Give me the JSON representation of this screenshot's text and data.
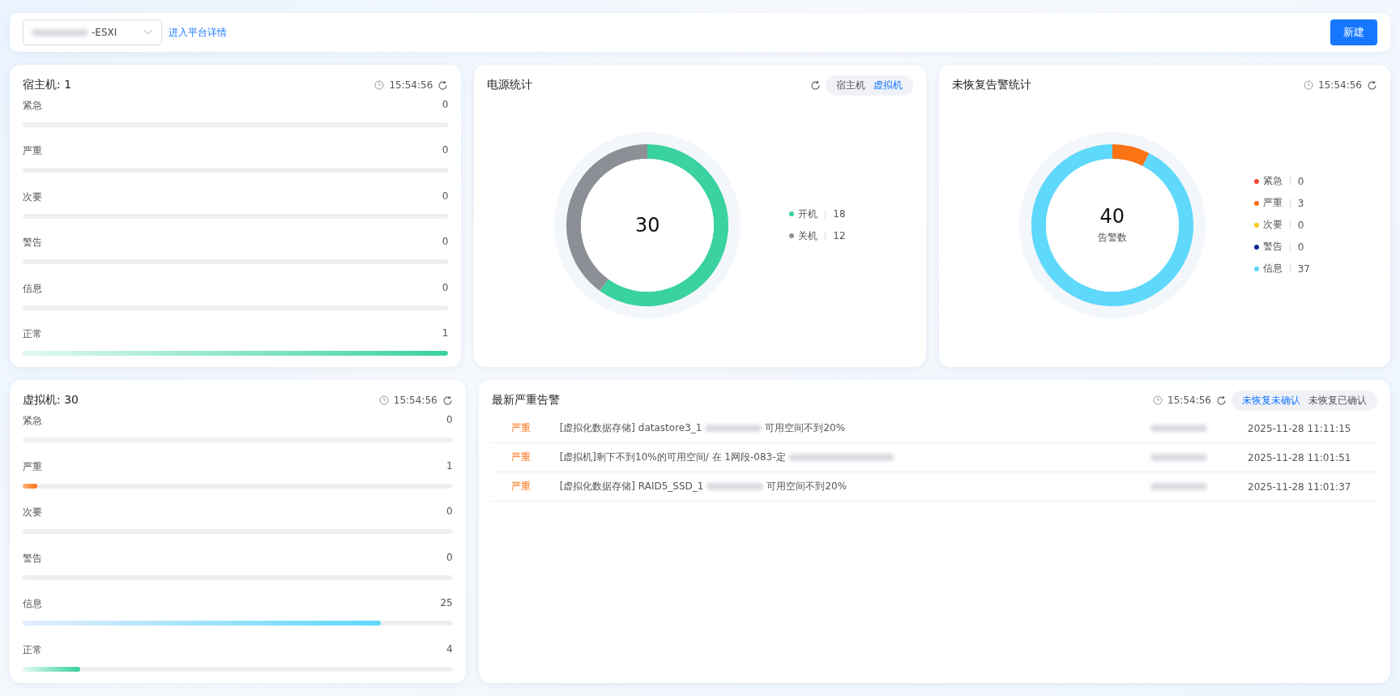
{
  "toolbar": {
    "platform_select": {
      "value": "-ESXI"
    },
    "detail_link": "进入平台详情",
    "new_button": "新建"
  },
  "host_card": {
    "title": "宿主机: 1",
    "time": "15:54:56",
    "rows": [
      {
        "label": "紧急",
        "count": "0",
        "kind": "urgent"
      },
      {
        "label": "严重",
        "count": "0",
        "kind": "critical"
      },
      {
        "label": "次要",
        "count": "0",
        "kind": "minor"
      },
      {
        "label": "警告",
        "count": "0",
        "kind": "warning"
      },
      {
        "label": "信息",
        "count": "0",
        "kind": "info"
      },
      {
        "label": "正常",
        "count": "1",
        "level": 1,
        "kind": "normal"
      }
    ]
  },
  "power_card": {
    "title": "电源统计",
    "tabs": [
      {
        "label": "宿主机",
        "selected": false
      },
      {
        "label": "虚拟机",
        "selected": true
      }
    ],
    "total": "30",
    "legend": [
      {
        "count": "18",
        "color": "#3ad29f"
      },
      {
        "count": "12",
        "color": "#8c8f96"
      }
    ],
    "chart_data": {
      "type": "donut",
      "categories": [
        "开机",
        "关机"
      ],
      "values": [
        60,
        40
      ]
    }
  },
  "alarm_card": {
    "title": "未恢复告警统计",
    "time": "15:54:56",
    "total": "40",
    "total_label": "告警数",
    "legend": [
      {
        "count": "0",
        "color": "#f5483b"
      },
      {
        "count": "3",
        "color": "#fa7315"
      },
      {
        "count": "0",
        "color": "#fac715"
      },
      {
        "count": "0",
        "color": "#0a2a9a"
      },
      {
        "count": "37",
        "color": "#5ed8fb"
      }
    ],
    "chart_data": {
      "type": "donut",
      "categories": [
        "紧急",
        "严重",
        "次要",
        "警告",
        "信息"
      ],
      "values": [
        0,
        7.5,
        0,
        0,
        92.5
      ]
    }
  },
  "vm_card": {
    "title": "虚拟机: 30",
    "time": "15:54:56",
    "rows": [
      {
        "label": "紧急",
        "count": "0",
        "kind": "urgent"
      },
      {
        "label": "严重",
        "count": "1",
        "level": 0.033,
        "kind": "critical"
      },
      {
        "label": "次要",
        "count": "0",
        "kind": "minor"
      },
      {
        "label": "警告",
        "count": "0",
        "kind": "warning"
      },
      {
        "label": "信息",
        "count": "25",
        "level": 0.833,
        "kind": "info"
      },
      {
        "label": "正常",
        "count": "4",
        "level": 0.133,
        "kind": "normal"
      }
    ]
  },
  "latest_alarms": {
    "title": "最新严重告警",
    "time": "15:54:56",
    "tabs": [
      {
        "label": "未恢复未确认",
        "selected": true
      },
      {
        "label": "未恢复已确认",
        "selected": false
      }
    ],
    "rows": [
      {
        "severity": "严重",
        "message_start": "[虚拟化数据存储] datastore3_1",
        "message_end": "可用空间不到20%",
        "time": "2025-11-28 11:11:15"
      },
      {
        "severity": "严重",
        "message_start": "[虚拟机]剩下不到10%的可用空间/ 在 1网段-083-定",
        "time": "2025-11-28 11:01:51"
      },
      {
        "severity": "严重",
        "message_start": "[虚拟化数据存储] RAID5_SSD_1",
        "message_end": "可用空间不到20%",
        "time": "2025-11-28 11:01:37"
      }
    ]
  }
}
